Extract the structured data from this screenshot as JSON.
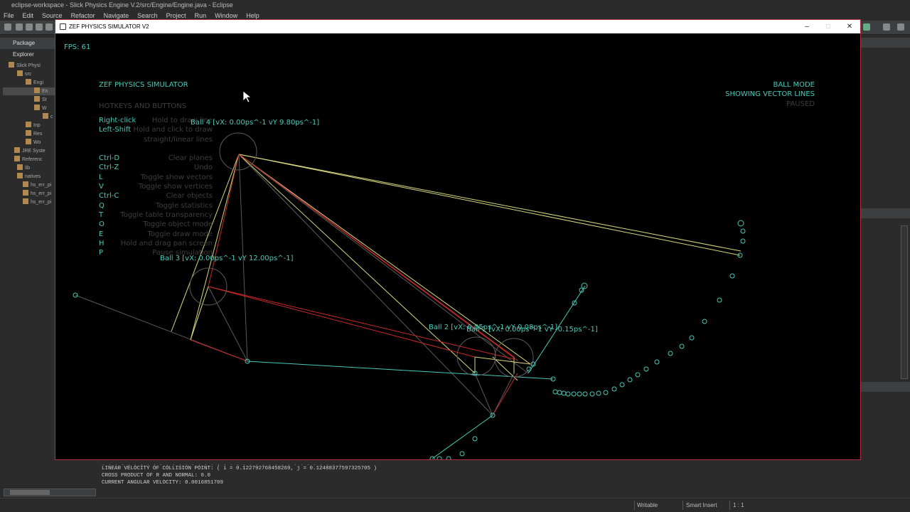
{
  "eclipse": {
    "title": "eclipse-workspace - Slick Physics Engine V.2/src/Engine/Engine.java - Eclipse",
    "menu": [
      "File",
      "Edit",
      "Source",
      "Refactor",
      "Navigate",
      "Search",
      "Project",
      "Run",
      "Window",
      "Help"
    ],
    "package_explorer": {
      "title": "Package Explorer",
      "items": [
        "Slick Physi",
        "src",
        "Engi",
        "En",
        "St",
        "W",
        "c",
        "Inp",
        "Res",
        "Wo",
        "JRE Syste",
        "Referenc",
        "lib",
        "natives",
        "hs_err_pi",
        "hs_err_pi",
        "hs_err_pi"
      ]
    },
    "console_lines": [
      "LINEAR VELOCITY OF COLLISION POINT: ( i = 0.122792768458269, j = 0.12488377597325705 )",
      "CROSS PRODUCT OF R AND NORMAL: 0.0",
      "CURRENT ANGULAR VELOCITY: 0.0016851709"
    ],
    "status_bar": {
      "writable": "Writable",
      "insert_mode": "Smart Insert",
      "position": "1 : 1"
    }
  },
  "sim": {
    "window_title": "ZEF PHYSICS SIMULATOR V2",
    "fps": "FPS: 61",
    "heading": "ZEF PHYSICS SIMULATOR",
    "hotkeys_title": "HOTKEYS AND BUTTONS",
    "hotkeys": [
      {
        "key": "Right-click",
        "desc": "Hold to draw line"
      },
      {
        "key": "Left-Shift",
        "desc": "Hold and click to draw"
      },
      {
        "key": "",
        "desc": "straight/linear lines"
      },
      {
        "key": "",
        "desc": ""
      },
      {
        "key": "Ctrl-D",
        "desc": "Clear planes"
      },
      {
        "key": "Ctrl-Z",
        "desc": "Undo"
      },
      {
        "key": "L",
        "desc": "Toggle show vectors"
      },
      {
        "key": "V",
        "desc": "Toggle show vertices"
      },
      {
        "key": "Ctrl-C",
        "desc": "Clear objects"
      },
      {
        "key": "Q",
        "desc": "Toggle statistics"
      },
      {
        "key": "T",
        "desc": "Toggle table transparency"
      },
      {
        "key": "O",
        "desc": "Toggle object mode"
      },
      {
        "key": "E",
        "desc": "Toggle draw mode"
      },
      {
        "key": "H",
        "desc": "Hold and drag pan screen"
      },
      {
        "key": "P",
        "desc": "Pause simulation"
      }
    ],
    "mode": "BALL MODE",
    "vector_status": "SHOWING VECTOR LINES",
    "paused": "PAUSED",
    "balls": {
      "ball4": "Ball 4 [vX: 0.00ps^-1 vY 9.80ps^-1]",
      "ball3": "Ball 3 [vX: 0.00ps^-1 vY 12.00ps^-1]",
      "ball2": "Ball 2 [vX: 0.05ps^-1 vY 0.08ps^-1]",
      "ball1": "Ball 1 [vX: 0.00ps^-1 vY -0.15ps^-1]"
    },
    "colors": {
      "text": "#49c9b8",
      "yellow": "#d8d880",
      "red": "#c82828",
      "cyan": "#49c9b8",
      "grey": "#606060"
    }
  }
}
